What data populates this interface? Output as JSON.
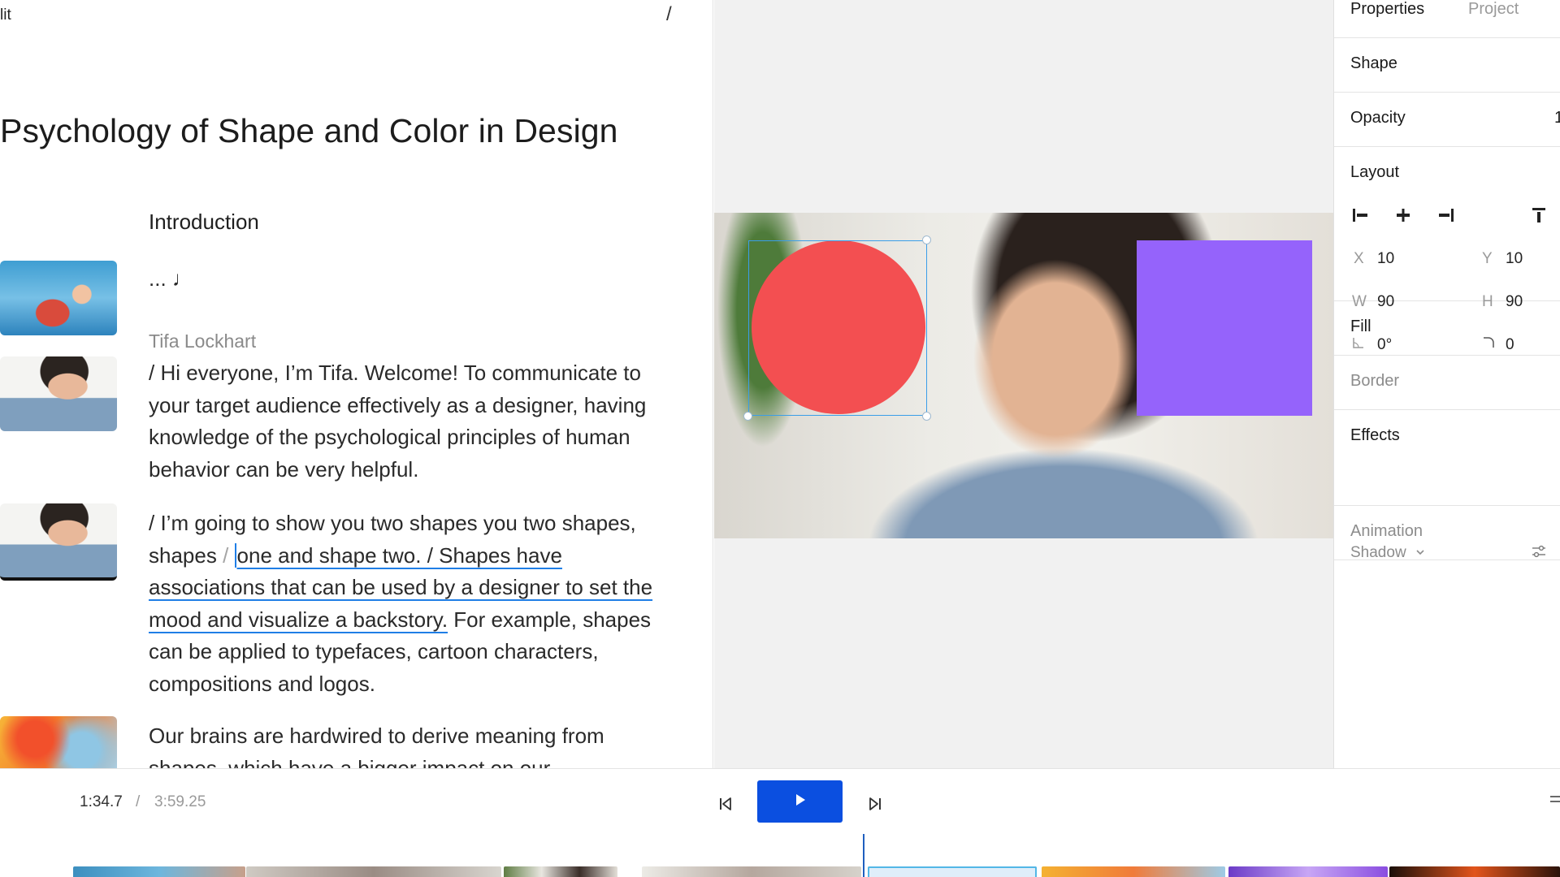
{
  "editor": {
    "top_label": "lit",
    "top_slash": "/",
    "title": "Psychology of Shape and Color in Design",
    "section_heading": "Introduction",
    "ellipsis_line": "... ♩",
    "speaker": "Tifa Lockhart",
    "para1": "/ Hi everyone, I’m Tifa. Welcome! To communicate to your target audience effectively as a designer, having knowledge of the psychological principles of human behavior can be very helpful.",
    "para2_a": "/ I’m going to show you two shapes you two shapes, shapes ",
    "para2_slash": "/ ",
    "para2_highlight": "one and shape two. / Shapes have associations that can be used by a designer to set the mood and visualize a backstory.",
    "para2_b": " For example, shapes can be applied to typefaces, cartoon characters, compositions and logos.",
    "para3": "Our brains are hardwired to derive meaning from shapes, which have a bigger impact on our"
  },
  "panel": {
    "tabs": [
      "Properties",
      "Project"
    ],
    "shape_label": "Shape",
    "opacity_label": "Opacity",
    "opacity_value": "1",
    "layout_label": "Layout",
    "x_label": "X",
    "x_value": "10",
    "y_label": "Y",
    "y_value": "10",
    "w_label": "W",
    "w_value": "90",
    "h_label": "H",
    "h_value": "90",
    "rotation_value": "0°",
    "radius_value": "0",
    "fill_label": "Fill",
    "border_label": "Border",
    "effects_label": "Effects",
    "shadow_label": "Shadow",
    "animation_label": "Animation"
  },
  "canvas": {
    "circle_color": "#f34f51",
    "square_color": "#9563fb",
    "selection_color": "#3a9ee8"
  },
  "transport": {
    "current_time": "1:34.7",
    "separator": "/",
    "total_time": "3:59.25",
    "play_color": "#0b4fe0"
  },
  "icons": [
    "align-left-icon",
    "align-center-icon",
    "align-right-icon",
    "align-top-icon",
    "rotation-icon",
    "corner-radius-icon",
    "chevron-down-icon",
    "settings-sliders-icon",
    "skip-back-icon",
    "play-icon",
    "skip-forward-icon",
    "menu-icon"
  ]
}
